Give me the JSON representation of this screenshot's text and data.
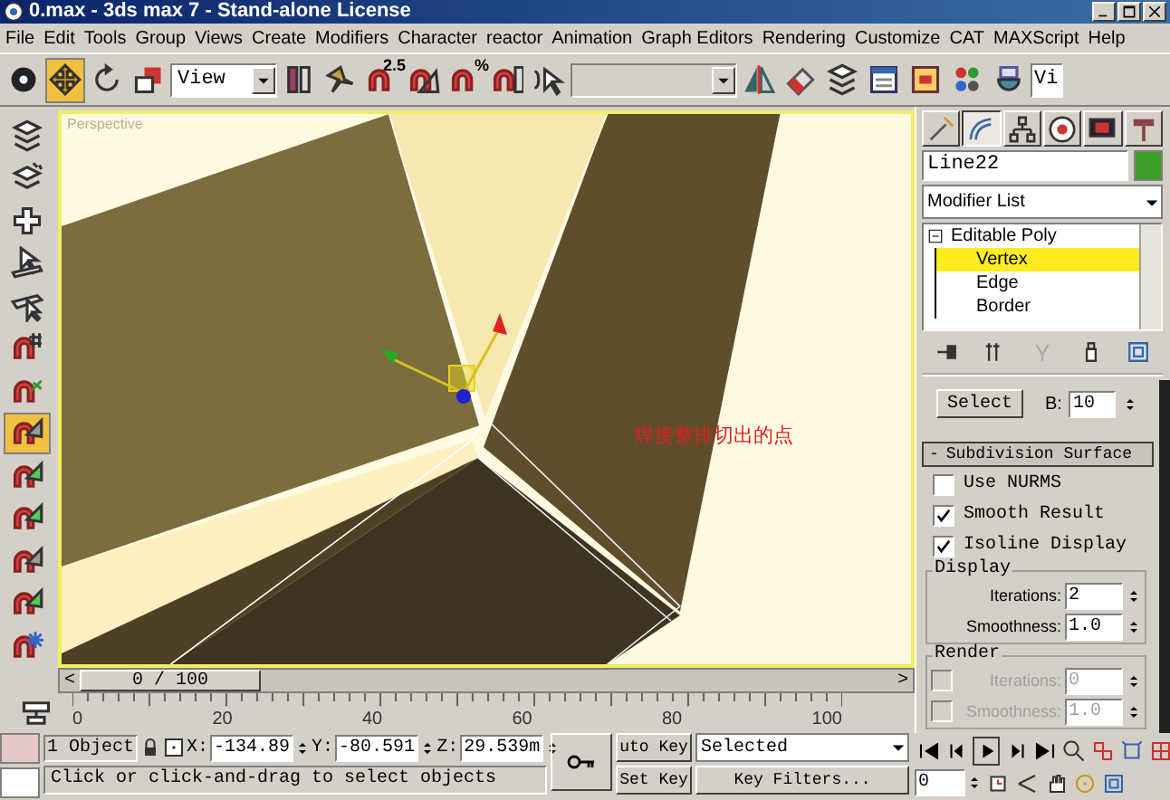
{
  "window": {
    "title": "0.max - 3ds max 7  - Stand-alone License"
  },
  "menu": [
    "File",
    "Edit",
    "Tools",
    "Group",
    "Views",
    "Create",
    "Modifiers",
    "Character",
    "reactor",
    "Animation",
    "Graph Editors",
    "Rendering",
    "Customize",
    "CAT",
    "MAXScript",
    "Help"
  ],
  "toolbar": [
    {
      "kind": "select-object",
      "selected": false
    },
    {
      "kind": "move",
      "selected": true
    },
    {
      "kind": "rotate",
      "selected": false
    },
    {
      "kind": "scale",
      "selected": false
    },
    {
      "kind": "dropdown",
      "value": "View"
    },
    {
      "kind": "pivot",
      "selected": false
    },
    {
      "kind": "manipulate",
      "selected": false
    },
    {
      "kind": "snap",
      "label": "2.5"
    },
    {
      "kind": "angle-snap",
      "selected": false
    },
    {
      "kind": "snap",
      "label": "%"
    },
    {
      "kind": "spinner-snap",
      "selected": false
    },
    {
      "kind": "named-selection",
      "selected": false
    },
    {
      "kind": "dropdown"
    },
    {
      "kind": "mirror",
      "selected": false
    },
    {
      "kind": "align",
      "selected": false
    },
    {
      "kind": "layers",
      "selected": false
    },
    {
      "kind": "curve-editor",
      "selected": false
    },
    {
      "kind": "schematic",
      "selected": false
    },
    {
      "kind": "material",
      "selected": false
    },
    {
      "kind": "render",
      "selected": false
    },
    {
      "kind": "dropdown",
      "value": "Vi"
    }
  ],
  "left_tools": [
    {
      "kind": "layers",
      "selected": false
    },
    {
      "kind": "layers-rays",
      "selected": false
    },
    {
      "kind": "plus",
      "selected": false
    },
    {
      "kind": "cursor-a",
      "selected": false
    },
    {
      "kind": "cursor-b",
      "selected": false
    },
    {
      "kind": "magnet-grid",
      "selected": false
    },
    {
      "kind": "magnet-leaf",
      "selected": false
    },
    {
      "kind": "magnet-tri",
      "selected": true
    },
    {
      "kind": "magnet-tri-green",
      "selected": false
    },
    {
      "kind": "magnet-tri-green",
      "selected": false
    },
    {
      "kind": "magnet-tri",
      "selected": false
    },
    {
      "kind": "magnet-tri-green",
      "selected": false
    },
    {
      "kind": "magnet-snow",
      "selected": false
    }
  ],
  "viewport": {
    "label": "Perspective",
    "annotation": "焊接整排切出的点"
  },
  "timeline": {
    "prev": "<",
    "slider": "0 / 100",
    "level": 0,
    "next": ">",
    "ticks": [
      "0",
      "20",
      "40",
      "60",
      "80",
      "100"
    ]
  },
  "status_bar": {
    "selection_count": "1 Object",
    "coords": [
      {
        "axis": "X:",
        "value": "-134.89"
      },
      {
        "axis": "Y:",
        "value": "-80.591"
      },
      {
        "axis": "Z:",
        "value": "29.539m"
      }
    ],
    "auto_key": "uto Key",
    "key_mode": "Selected",
    "set_key": "Set Key",
    "key_filters": "Key Filters...",
    "prompt": "Click or click-and-drag to select objects",
    "current_frame": "0"
  },
  "command_panel": {
    "tabs": [
      {
        "kind": "create",
        "selected": false
      },
      {
        "kind": "modify",
        "selected": true
      },
      {
        "kind": "hierarchy",
        "selected": false
      },
      {
        "kind": "motion",
        "selected": false
      },
      {
        "kind": "display",
        "selected": false
      },
      {
        "kind": "utilities",
        "selected": false
      }
    ],
    "object_name": "Line22",
    "modifier_list": "Modifier List",
    "stack": [
      {
        "label": "Editable Poly",
        "expanded": true,
        "selected": false,
        "children": [
          {
            "label": "Vertex",
            "selected": true
          },
          {
            "label": "Edge",
            "selected": false
          },
          {
            "label": "Border",
            "selected": false
          }
        ]
      }
    ],
    "select_button": "Select",
    "b_label": "B:",
    "b_value": "10",
    "rollout": {
      "title": "Subdivision Surface",
      "collapse_sign": "-",
      "options": [
        {
          "label": "Use NURMS",
          "checked": false
        },
        {
          "label": "Smooth Result",
          "checked": true
        },
        {
          "label": "Isoline Display",
          "checked": true
        }
      ],
      "display": {
        "title": "Display",
        "fields": [
          {
            "label": "Iterations:",
            "value": "2"
          },
          {
            "label": "Smoothness:",
            "value": "1.0"
          }
        ]
      },
      "render": {
        "title": "Render",
        "fields": [
          {
            "label": "Iterations:",
            "value": "0",
            "checked": false,
            "disabled": true
          },
          {
            "label": "Smoothness:",
            "value": "1.0",
            "checked": false,
            "disabled": true
          }
        ]
      }
    }
  }
}
